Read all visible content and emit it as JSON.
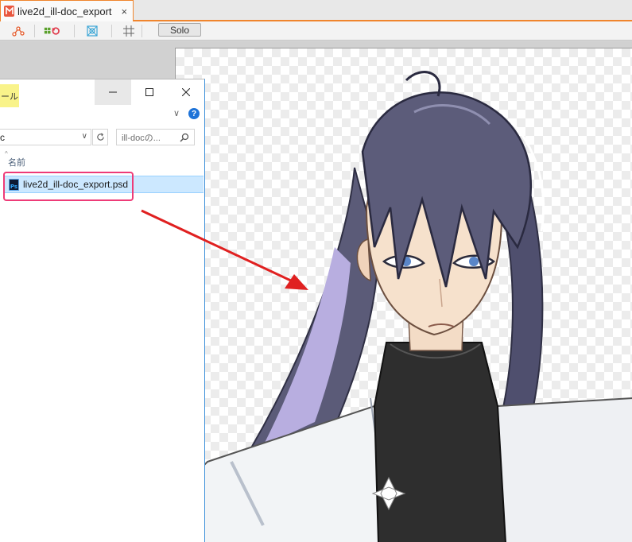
{
  "tab": {
    "title": "live2d_ill-doc_export",
    "close_glyph": "×"
  },
  "toolbar": {
    "buttons": [
      {
        "icon": "node-graph-icon"
      },
      {
        "icon": "visibility-toggle-icon"
      },
      {
        "icon": "target-grid-icon"
      },
      {
        "icon": "grid-icon"
      }
    ],
    "solo_label": "Solo"
  },
  "explorer": {
    "ribbon_tab_label": "ール",
    "address_text": "c",
    "search_placeholder": "ill-docの...",
    "column_header": "名前",
    "file": {
      "name": "live2d_ill-doc_export.psd",
      "icon_label": "Ps"
    },
    "help_glyph": "?"
  },
  "colors": {
    "accent_orange": "#f0852d",
    "highlight_pink": "#ee3b78",
    "arrow_red": "#e02020",
    "selection_blue": "#cce8ff"
  }
}
